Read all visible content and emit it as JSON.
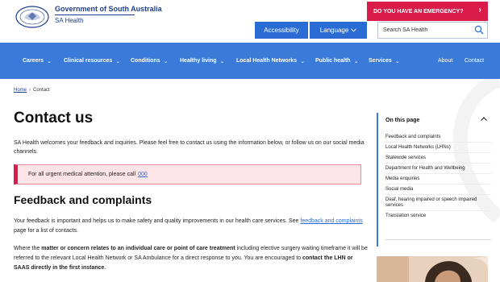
{
  "header": {
    "org_title": "Government of South Australia",
    "org_sub": "SA Health",
    "emergency_label": "DO YOU HAVE AN EMERGENCY?",
    "accessibility_label": "Accessibility",
    "language_label": "Language",
    "search_placeholder": "Search SA Health"
  },
  "nav": {
    "items": [
      {
        "label": "Careers"
      },
      {
        "label": "Clinical resources"
      },
      {
        "label": "Conditions"
      },
      {
        "label": "Healthy living"
      },
      {
        "label": "Local Health Networks"
      },
      {
        "label": "Public health"
      },
      {
        "label": "Services"
      },
      {
        "label": "About"
      },
      {
        "label": "Contact"
      }
    ]
  },
  "breadcrumb": {
    "home": "Home",
    "separator": "›",
    "current": "Contact"
  },
  "main": {
    "title": "Contact us",
    "intro": "SA Health welcomes your feedback and inquiries. Please feel free to contact us using the information below, or follow us on our social media channels.",
    "alert_text": "For all urgent medical attention, please call",
    "alert_link": "000",
    "section_heading": "Feedback and complaints",
    "para1_before": "Your feedback is important and helps us to make safety and quality improvements in our health care services. See",
    "para1_link": "feedback and complaints",
    "para1_after": "page for a list of contacts.",
    "para2_a": "Where the",
    "para2_b": "matter or concern relates to an individual care or point of care treatment",
    "para2_c": "including elective surgery waiting timeframe it will be referred to the relevant Local Health Network or SA Ambulance for a direct response to you. You are encouraged to",
    "para2_d": "contact the LHN or SAAS directly in the first instance",
    "para2_e": "."
  },
  "on_this_page": {
    "title": "On this page",
    "items": [
      "Feedback and complaints",
      "Local Health Networks (LHNs)",
      "Statewide services",
      "Department for Health and Wellbeing",
      "Media enquiries",
      "Social media",
      "Deaf, hearing impaired or speech impaired services",
      "Translation service"
    ]
  },
  "colors": {
    "brand_blue": "#1d3f8c",
    "nav_blue": "#3a7ad9",
    "button_blue": "#2b6cd4",
    "emergency_red": "#d91c4a",
    "alert_bg": "#fde4e8"
  }
}
